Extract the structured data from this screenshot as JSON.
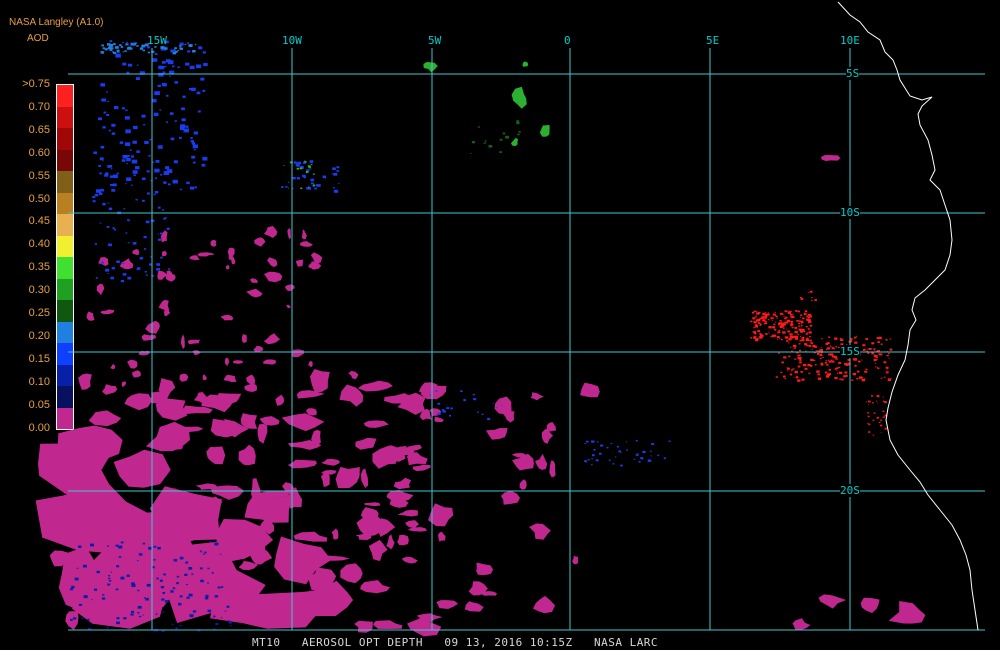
{
  "header": {
    "source": "NASA Langley (A1.0)",
    "parameter": "AOD"
  },
  "colorbar": {
    "labels": [
      ">0.75",
      "0.70",
      "0.65",
      "0.60",
      "0.55",
      "0.50",
      "0.45",
      "0.40",
      "0.35",
      "0.30",
      "0.25",
      "0.20",
      "0.15",
      "0.10",
      "0.05",
      "0.00"
    ],
    "colors": [
      "#ff2020",
      "#cc1010",
      "#a00808",
      "#780808",
      "#806018",
      "#b88020",
      "#e8b050",
      "#f0f030",
      "#40e030",
      "#20a020",
      "#105810",
      "#2080e0",
      "#1040ff",
      "#0820a8",
      "#081060",
      "#c02890"
    ]
  },
  "grid": {
    "lon_labels": [
      "15W",
      "10W",
      "5W",
      "0",
      "5E",
      "10E"
    ],
    "lat_labels": [
      "5S",
      "10S",
      "15S",
      "20S"
    ],
    "line_color": "#40c8d0"
  },
  "footer": {
    "product": "MT10",
    "title": "AEROSOL OPT DEPTH",
    "date": "09 13, 2016",
    "time": "10:15Z",
    "agency": "NASA LARC"
  }
}
